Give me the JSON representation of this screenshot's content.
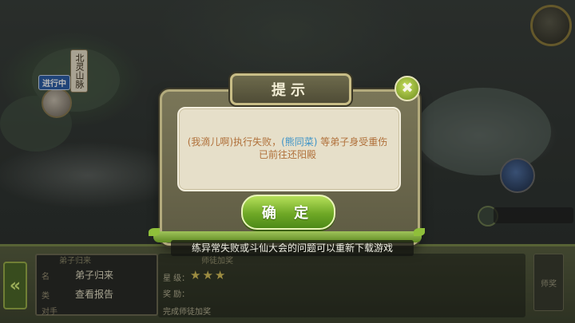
{
  "map": {
    "region_label": "北灵山脉",
    "status_tag": "进行中"
  },
  "dialog": {
    "title": "提示",
    "close_symbol": "✖",
    "message_prefix": "(我滴儿啊)执行失败，",
    "highlight_name": "(熊同菜)",
    "message_suffix": "等弟子身受重伤已前往还阳殿",
    "confirm_label": "确 定"
  },
  "banner": {
    "text": "练异常失败或斗仙大会的问题可以重新下载游戏"
  },
  "bottom_panel": {
    "card_header": "弟子归来",
    "rows": [
      "弟子归来",
      "查看报告"
    ],
    "side_labels": [
      "名",
      "类",
      "对手"
    ],
    "mid_header": "师徒加奖",
    "mid_labels": [
      "星 级：",
      "奖 励：",
      "完成师徒加奖"
    ],
    "stars": "★★★",
    "right_label": "师奖"
  },
  "colors": {
    "message_text": "#b0703a",
    "highlight": "#3d93c8",
    "confirm_green": "#6fa826",
    "frame": "#5e5b43"
  }
}
